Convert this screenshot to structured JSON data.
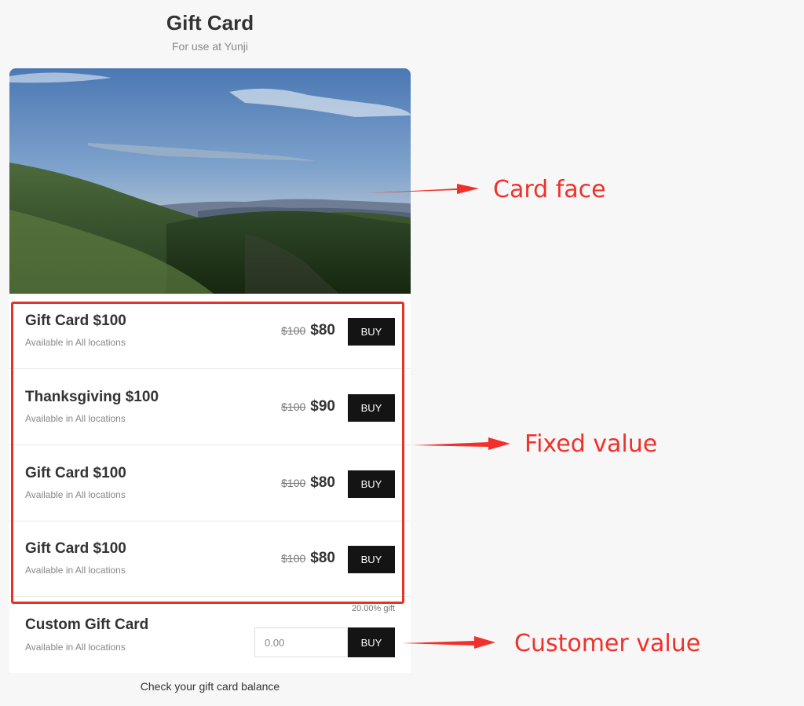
{
  "header": {
    "title": "Gift Card",
    "subtitle": "For use at Yunji"
  },
  "card_image": {
    "description_icon": "landscape-photo"
  },
  "gift_cards": [
    {
      "name": "Gift Card $100",
      "location": "Available in All locations",
      "original_price": "$100",
      "price": "$80",
      "button": "BUY"
    },
    {
      "name": "Thanksgiving $100",
      "location": "Available in All locations",
      "original_price": "$100",
      "price": "$90",
      "button": "BUY"
    },
    {
      "name": "Gift Card $100",
      "location": "Available in All locations",
      "original_price": "$100",
      "price": "$80",
      "button": "BUY"
    },
    {
      "name": "Gift Card $100",
      "location": "Available in All locations",
      "original_price": "$100",
      "price": "$80",
      "button": "BUY"
    }
  ],
  "custom_card": {
    "name": "Custom Gift Card",
    "location": "Available in All locations",
    "gift_rate": "20.00% gift",
    "amount_placeholder": "0.00",
    "button": "BUY"
  },
  "footer": {
    "balance_link": "Check your gift card balance"
  },
  "annotations": {
    "card_face": "Card face",
    "fixed_value": "Fixed value",
    "customer_value": "Customer value"
  },
  "colors": {
    "button_bg": "#141414",
    "annotation_red": "#f0312b",
    "page_bg": "#f7f7f7"
  }
}
